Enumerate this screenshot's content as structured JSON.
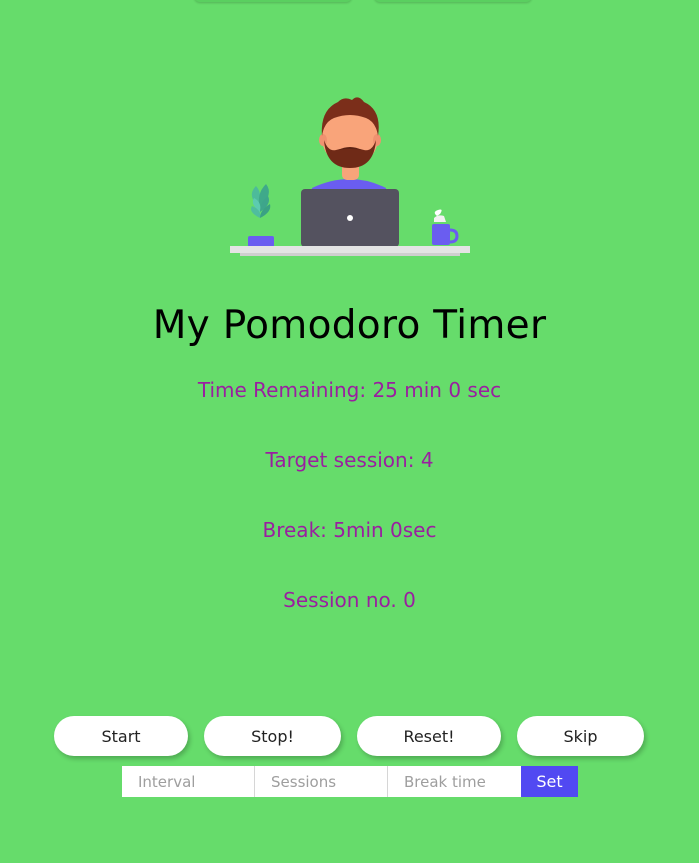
{
  "app": {
    "title": "My Pomodoro Timer"
  },
  "status": {
    "time_remaining": "Time Remaining: 25 min 0 sec",
    "target_session": "Target session: 4",
    "break": "Break: 5min 0sec",
    "session_no": "Session no. 0"
  },
  "controls": {
    "start_label": "Start",
    "stop_label": "Stop!",
    "reset_label": "Reset!",
    "skip_label": "Skip"
  },
  "settings": {
    "interval_placeholder": "Interval",
    "sessions_placeholder": "Sessions",
    "break_placeholder": "Break time",
    "set_label": "Set"
  },
  "colors": {
    "background": "#66dc6b",
    "info_text": "#9a1fa0",
    "set_button": "#5149f2"
  },
  "icons": {
    "illustration": "person-at-laptop-illustration"
  }
}
